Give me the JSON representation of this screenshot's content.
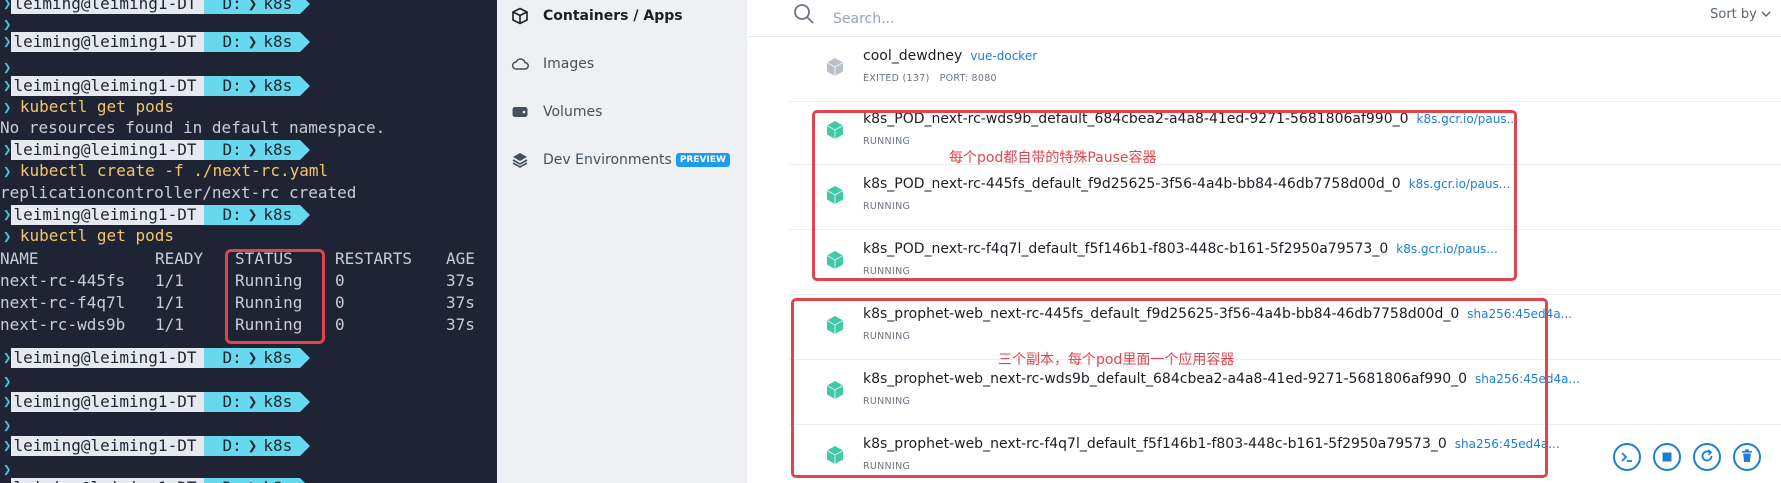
{
  "terminal": {
    "prompt": {
      "user": "leiming@leiming1-DT",
      "drive": "D:",
      "dir": "k8s"
    },
    "cmd_get_pods": "kubectl get pods",
    "no_resources": "No resources found in default namespace.",
    "cmd_create": "kubectl create -f ./next-rc.yaml",
    "created_msg": "replicationcontroller/next-rc created",
    "table_headers": [
      "NAME",
      "READY",
      "STATUS",
      "RESTARTS",
      "AGE"
    ],
    "pods": [
      [
        "next-rc-445fs",
        "1/1",
        "Running",
        "0",
        "37s"
      ],
      [
        "next-rc-f4q7l",
        "1/1",
        "Running",
        "0",
        "37s"
      ],
      [
        "next-rc-wds9b",
        "1/1",
        "Running",
        "0",
        "37s"
      ]
    ]
  },
  "nav": {
    "items": [
      {
        "label": "Containers / Apps",
        "icon": "container-icon",
        "active": true
      },
      {
        "label": "Images",
        "icon": "cloud-icon",
        "active": false
      },
      {
        "label": "Volumes",
        "icon": "volume-icon",
        "active": false
      },
      {
        "label": "Dev Environments",
        "icon": "dev-env-icon",
        "active": false,
        "badge": "PREVIEW"
      }
    ]
  },
  "search": {
    "placeholder": "Search...",
    "sort_label": "Sort by"
  },
  "containers": [
    {
      "name": "cool_dewdney",
      "image": "vue-docker",
      "status": "EXITED (137)",
      "port": "PORT: 8080",
      "running": false
    },
    {
      "name": "k8s_POD_next-rc-wds9b_default_684cbea2-a4a8-41ed-9271-5681806af990_0",
      "image": "k8s.gcr.io/paus...",
      "status": "RUNNING",
      "running": true
    },
    {
      "name": "k8s_POD_next-rc-445fs_default_f9d25625-3f56-4a4b-bb84-46db7758d00d_0",
      "image": "k8s.gcr.io/paus...",
      "status": "RUNNING",
      "running": true
    },
    {
      "name": "k8s_POD_next-rc-f4q7l_default_f5f146b1-f803-448c-b161-5f2950a79573_0",
      "image": "k8s.gcr.io/paus...",
      "status": "RUNNING",
      "running": true
    },
    {
      "name": "k8s_prophet-web_next-rc-445fs_default_f9d25625-3f56-4a4b-bb84-46db7758d00d_0",
      "image": "sha256:45ed4a...",
      "status": "RUNNING",
      "running": true
    },
    {
      "name": "k8s_prophet-web_next-rc-wds9b_default_684cbea2-a4a8-41ed-9271-5681806af990_0",
      "image": "sha256:45ed4a...",
      "status": "RUNNING",
      "running": true
    },
    {
      "name": "k8s_prophet-web_next-rc-f4q7l_default_f5f146b1-f803-448c-b161-5f2950a79573_0",
      "image": "sha256:45ed4a...",
      "status": "RUNNING",
      "running": true
    }
  ],
  "annotations": {
    "pause_note": "每个pod都自带的特殊Pause容器",
    "replica_note": "三个副本，每个pod里面一个应用容器"
  },
  "actions": [
    {
      "name": "cli-button",
      "icon": "terminal-icon"
    },
    {
      "name": "stop-button",
      "icon": "stop-icon"
    },
    {
      "name": "restart-button",
      "icon": "restart-icon"
    },
    {
      "name": "delete-button",
      "icon": "trash-icon"
    }
  ],
  "colors": {
    "accent": "#1d7ed6",
    "annotation": "#e0454e",
    "running_icon": "#3fc9a6",
    "exited_icon": "#b9c0c8",
    "terminal_bg": "#1e2433"
  }
}
